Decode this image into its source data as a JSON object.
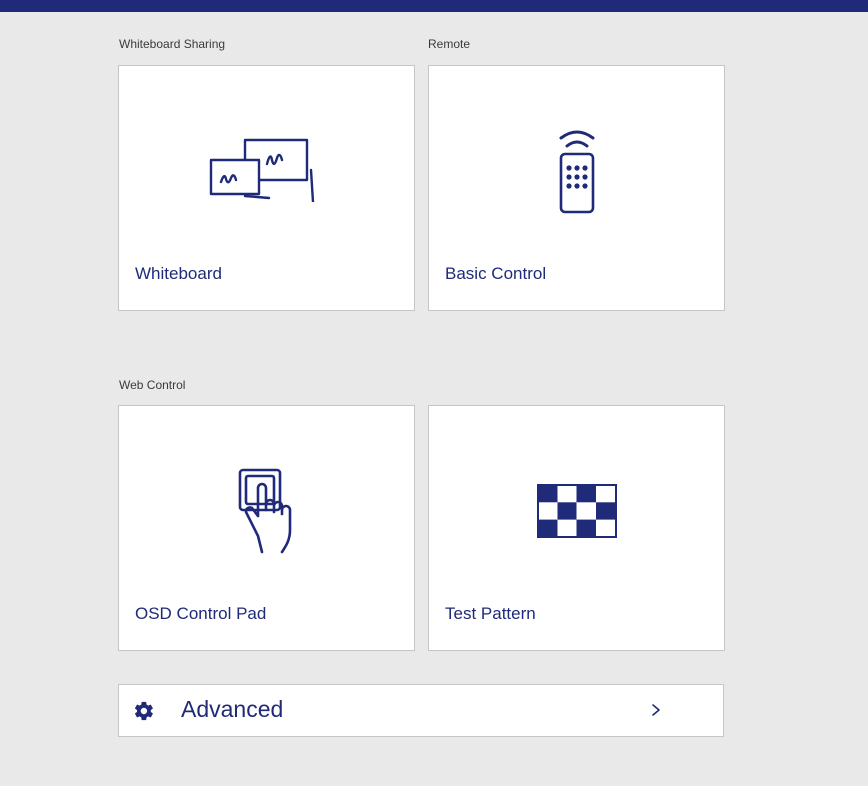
{
  "colors": {
    "accent": "#1f2a78",
    "background": "#e9e9e9",
    "tile": "#ffffff"
  },
  "sections": {
    "whiteboard_sharing": "Whiteboard Sharing",
    "remote": "Remote",
    "web_control": "Web Control"
  },
  "tiles": [
    {
      "label": "Whiteboard",
      "icon": "whiteboard-icon"
    },
    {
      "label": "Basic Control",
      "icon": "remote-control-icon"
    },
    {
      "label": "OSD Control Pad",
      "icon": "touch-pad-hand-icon"
    },
    {
      "label": "Test Pattern",
      "icon": "checker-pattern-icon"
    }
  ],
  "advanced": {
    "label": "Advanced",
    "icon": "gear-icon",
    "chevron": "chevron-right-icon"
  }
}
